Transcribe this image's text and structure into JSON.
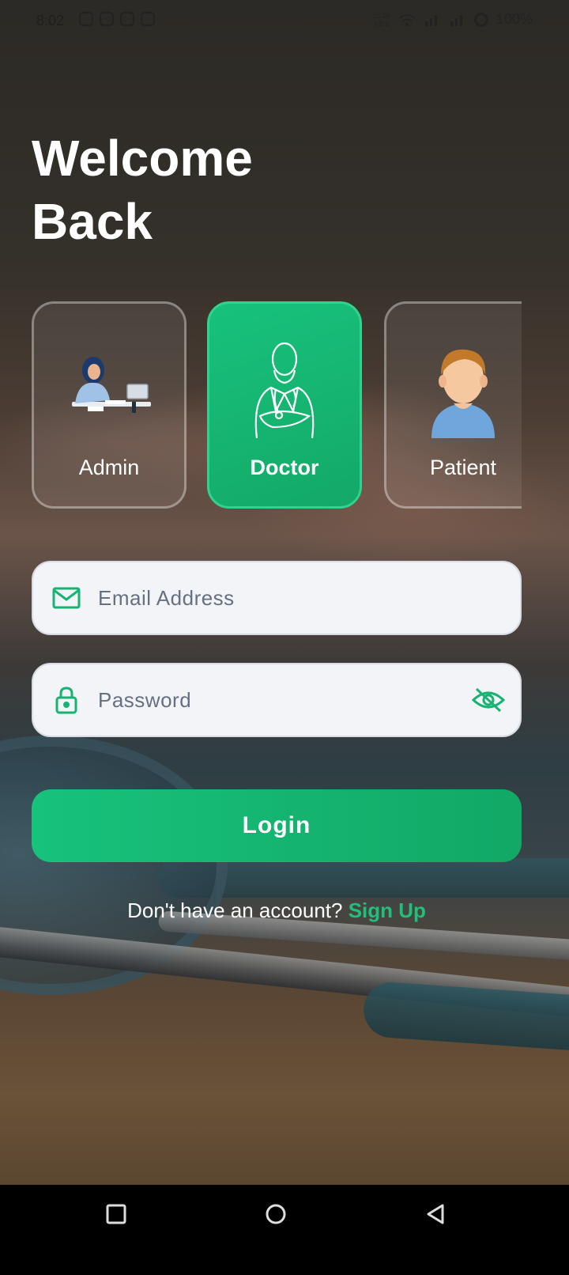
{
  "status_bar": {
    "time": "8:02",
    "speed_value": "25.09",
    "speed_unit": "KB/s",
    "battery": "100%"
  },
  "title_line1": "Welcome",
  "title_line2": "Back",
  "roles": [
    {
      "label": "Admin",
      "selected": false,
      "icon": "admin-illustration"
    },
    {
      "label": "Doctor",
      "selected": true,
      "icon": "doctor-outline-icon"
    },
    {
      "label": "Patient",
      "selected": false,
      "icon": "patient-avatar"
    }
  ],
  "email": {
    "placeholder": "Email Address",
    "icon": "mail-icon"
  },
  "password": {
    "placeholder": "Password",
    "icon": "lock-icon",
    "toggle_icon": "eye-off-icon"
  },
  "login_label": "Login",
  "signup": {
    "prompt": "Don't have an account?",
    "link": "Sign Up"
  },
  "colors": {
    "accent": "#17c27c",
    "field_bg": "#f3f4f8"
  }
}
